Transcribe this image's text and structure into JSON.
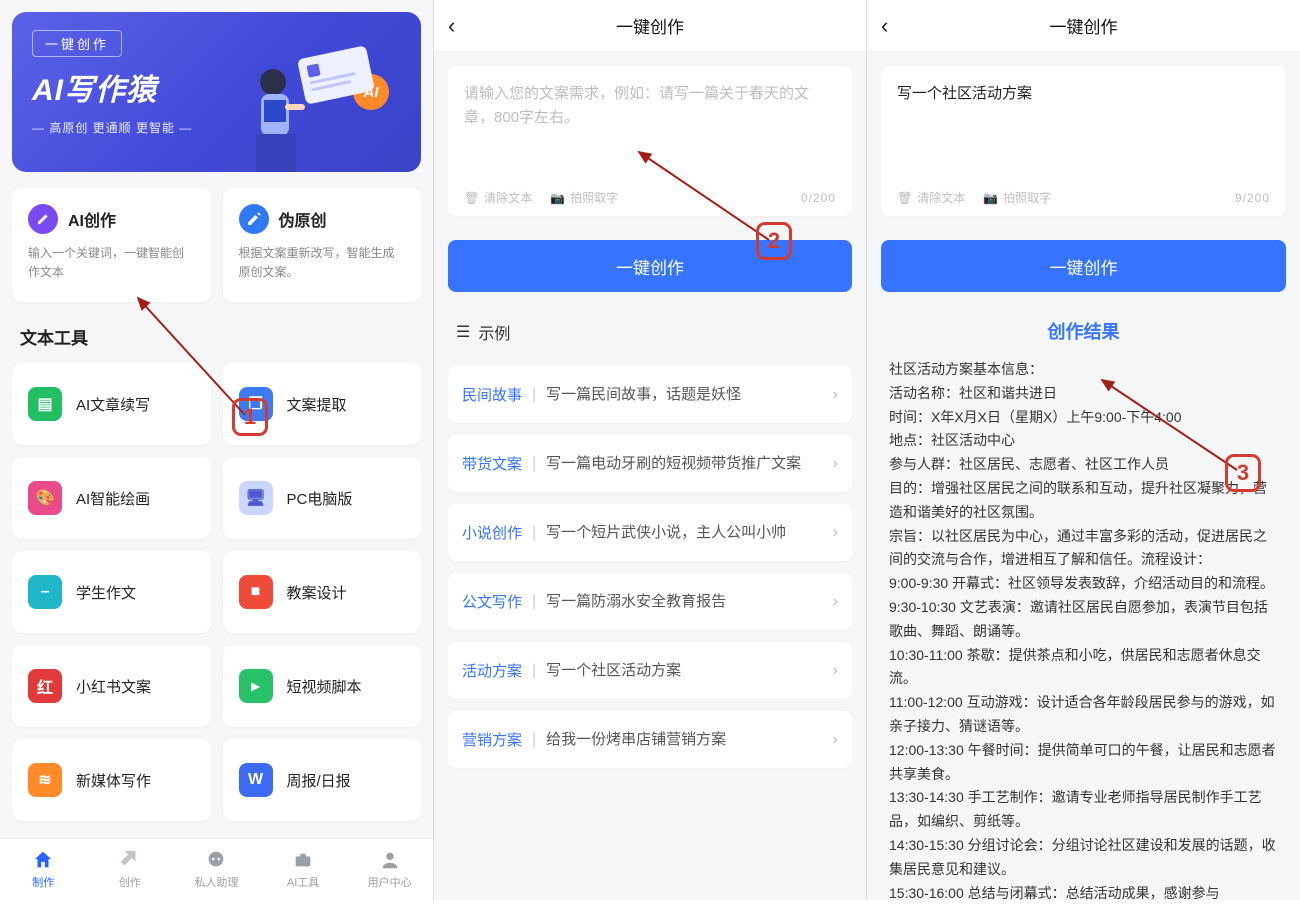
{
  "pane1": {
    "hero": {
      "pill": "一键创作",
      "title": "AI写作猿",
      "sub": "— 高原创 更通顺 更智能 —",
      "ai_badge": "AI"
    },
    "main_cards": [
      {
        "icon_name": "pen-icon",
        "title": "AI创作",
        "desc": "输入一个关键词，一键智能创作文本"
      },
      {
        "icon_name": "rewrite-icon",
        "title": "伪原创",
        "desc": "根据文案重新改写，智能生成原创文案。"
      }
    ],
    "section_title": "文本工具",
    "tools": [
      {
        "label": "AI文章续写",
        "cls": "tg-green",
        "icon": "document-icon",
        "glyph": "▤"
      },
      {
        "label": "文案提取",
        "cls": "tg-blue",
        "icon": "extract-icon",
        "glyph": "❐"
      },
      {
        "label": "AI智能绘画",
        "cls": "tg-pink",
        "icon": "palette-icon",
        "glyph": "🎨"
      },
      {
        "label": "PC电脑版",
        "cls": "tg-pc",
        "icon": "monitor-icon",
        "glyph": "🖥"
      },
      {
        "label": "学生作文",
        "cls": "tg-cyan",
        "icon": "essay-icon",
        "glyph": "–"
      },
      {
        "label": "教案设计",
        "cls": "tg-red",
        "icon": "book-icon",
        "glyph": "■"
      },
      {
        "label": "小红书文案",
        "cls": "tg-hong",
        "icon": "xiaohongshu-icon",
        "glyph": "红"
      },
      {
        "label": "短视频脚本",
        "cls": "tg-cam",
        "icon": "video-icon",
        "glyph": "▸"
      },
      {
        "label": "新媒体写作",
        "cls": "tg-or",
        "icon": "media-icon",
        "glyph": "≋"
      },
      {
        "label": "周报/日报",
        "cls": "tg-w",
        "icon": "report-icon",
        "glyph": "W"
      }
    ],
    "tabs": [
      {
        "label": "制作",
        "icon": "home-icon",
        "active": true
      },
      {
        "label": "创作",
        "icon": "tools-icon",
        "active": false
      },
      {
        "label": "私人助理",
        "icon": "chat-icon",
        "active": false
      },
      {
        "label": "AI工具",
        "icon": "briefcase-icon",
        "active": false
      },
      {
        "label": "用户中心",
        "icon": "user-icon",
        "active": false
      }
    ],
    "annotation": "1"
  },
  "pane2": {
    "header": "一键创作",
    "placeholder": "请输入您的文案需求，例如：请写一篇关于春天的文章，800字左右。",
    "clear_label": "清除文本",
    "camera_label": "拍照取字",
    "count": "0/200",
    "button": "一键创作",
    "examples_title": "示例",
    "examples": [
      {
        "tag": "民间故事",
        "text": "写一篇民间故事，话题是妖怪"
      },
      {
        "tag": "带货文案",
        "text": "写一篇电动牙刷的短视频带货推广文案"
      },
      {
        "tag": "小说创作",
        "text": "写一个短片武侠小说，主人公叫小帅"
      },
      {
        "tag": "公文写作",
        "text": "写一篇防溺水安全教育报告"
      },
      {
        "tag": "活动方案",
        "text": "写一个社区活动方案"
      },
      {
        "tag": "营销方案",
        "text": "给我一份烤串店铺营销方案"
      }
    ],
    "annotation": "2"
  },
  "pane3": {
    "header": "一键创作",
    "input_value": "写一个社区活动方案",
    "clear_label": "清除文本",
    "camera_label": "拍照取字",
    "count": "9/200",
    "button": "一键创作",
    "result_title": "创作结果",
    "result_body": "社区活动方案基本信息：\n活动名称：社区和谐共进日\n时间：X年X月X日（星期X）上午9:00-下午4:00\n地点：社区活动中心\n参与人群：社区居民、志愿者、社区工作人员\n目的：增强社区居民之间的联系和互动，提升社区凝聚力，营造和谐美好的社区氛围。\n宗旨：以社区居民为中心，通过丰富多彩的活动，促进居民之间的交流与合作，增进相互了解和信任。流程设计：\n9:00-9:30 开幕式：社区领导发表致辞，介绍活动目的和流程。\n9:30-10:30 文艺表演：邀请社区居民自愿参加，表演节目包括歌曲、舞蹈、朗诵等。\n10:30-11:00 茶歇：提供茶点和小吃，供居民和志愿者休息交流。\n11:00-12:00 互动游戏：设计适合各年龄段居民参与的游戏，如亲子接力、猜谜语等。\n12:00-13:30 午餐时间：提供简单可口的午餐，让居民和志愿者共享美食。\n13:30-14:30 手工艺制作：邀请专业老师指导居民制作手工艺品，如编织、剪纸等。\n14:30-15:30 分组讨论会：分组讨论社区建设和发展的话题，收集居民意见和建议。\n15:30-16:00 总结与闭幕式：总结活动成果，感谢参与",
    "annotation": "3"
  }
}
